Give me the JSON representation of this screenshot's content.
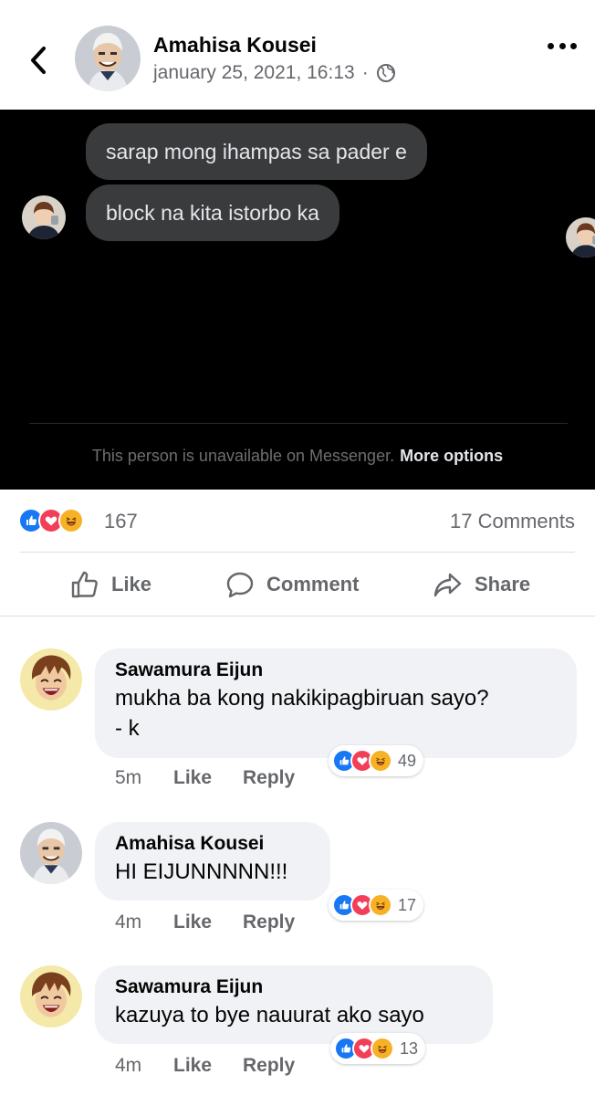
{
  "post": {
    "author": "Amahisa Kousei",
    "timestamp": "january 25, 2021, 16:13",
    "separator": "·",
    "privacy_icon": "globe-icon"
  },
  "screenshot": {
    "messages": [
      "sarap mong ihampas sa pader e",
      "block na kita istorbo ka"
    ],
    "notice": "This person is unavailable on Messenger.",
    "notice_link": "More options"
  },
  "summary": {
    "reaction_count": "167",
    "comments_count": "17 Comments",
    "reactions": [
      "like",
      "love",
      "haha"
    ]
  },
  "actions": {
    "like": "Like",
    "comment": "Comment",
    "share": "Share"
  },
  "comments": [
    {
      "name": "Sawamura Eijun",
      "text": "mukha ba kong nakikipagbiruan sayo?\n- k",
      "time": "5m",
      "like": "Like",
      "reply": "Reply",
      "reactions": "49"
    },
    {
      "name": "Amahisa Kousei",
      "text": "HI EIJUNNNNN!!!",
      "time": "4m",
      "like": "Like",
      "reply": "Reply",
      "reactions": "17"
    },
    {
      "name": "Sawamura Eijun",
      "text": "kazuya to bye nauurat ako sayo",
      "time": "4m",
      "like": "Like",
      "reply": "Reply",
      "reactions": "13"
    }
  ],
  "colors": {
    "fb_blue": "#1877f2",
    "love_red": "#f33e58",
    "haha_yellow": "#f7b125",
    "muted_text": "#65676b",
    "bubble_bg": "#f0f2f5"
  }
}
